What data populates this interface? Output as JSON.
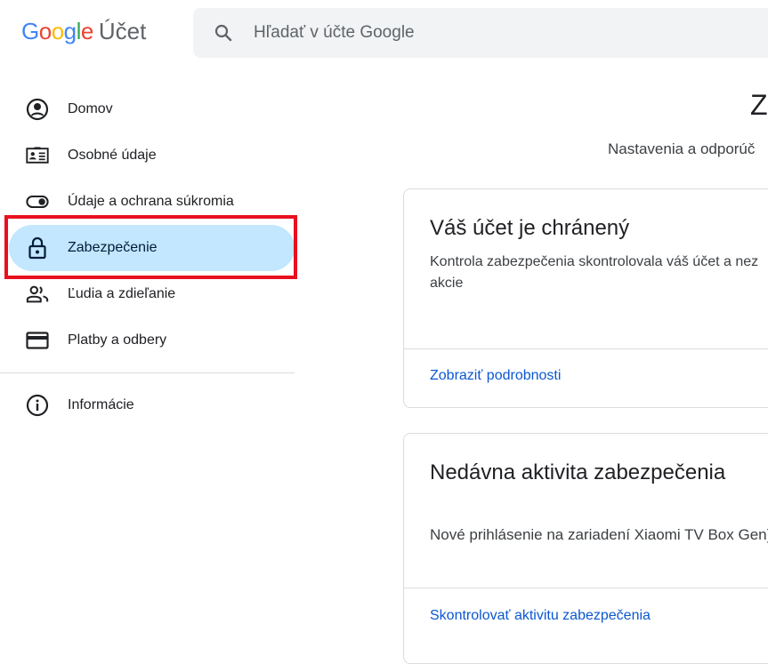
{
  "header": {
    "logo_google": "Google",
    "logo_product": "Účet",
    "logo_colors": [
      "#4285F4",
      "#EA4335",
      "#FBBC05",
      "#4285F4",
      "#34A853",
      "#EA4335"
    ],
    "search": {
      "placeholder": "Hľadať v účte Google",
      "icon": "search-icon"
    }
  },
  "sidebar": {
    "items": [
      {
        "label": "Domov",
        "icon": "account-circle-icon"
      },
      {
        "label": "Osobné údaje",
        "icon": "id-card-icon"
      },
      {
        "label": "Údaje a ochrana súkromia",
        "icon": "toggle-icon"
      },
      {
        "label": "Zabezpečenie",
        "icon": "lock-icon",
        "active": true
      },
      {
        "label": "Ľudia a zdieľanie",
        "icon": "people-icon"
      },
      {
        "label": "Platby a odbery",
        "icon": "credit-card-icon"
      }
    ],
    "secondary": [
      {
        "label": "Informácie",
        "icon": "info-icon"
      }
    ],
    "active_color": "#c2e7ff",
    "highlight_color": "#e8101e"
  },
  "main": {
    "title": "Z",
    "subtitle": "Nastavenia a odporúč",
    "cards": [
      {
        "title": "Váš účet je chránený",
        "text": "Kontrola zabezpečenia skontrolovala váš účet a nez akcie",
        "link": "Zobraziť podrobnosti"
      },
      {
        "title": "Nedávna aktivita zabezpečenia",
        "text": "Nové prihlásenie na zariadení Xiaomi TV Box Gen)",
        "link": "Skontrolovať aktivitu zabezpečenia"
      }
    ],
    "link_color": "#0b57d0"
  }
}
